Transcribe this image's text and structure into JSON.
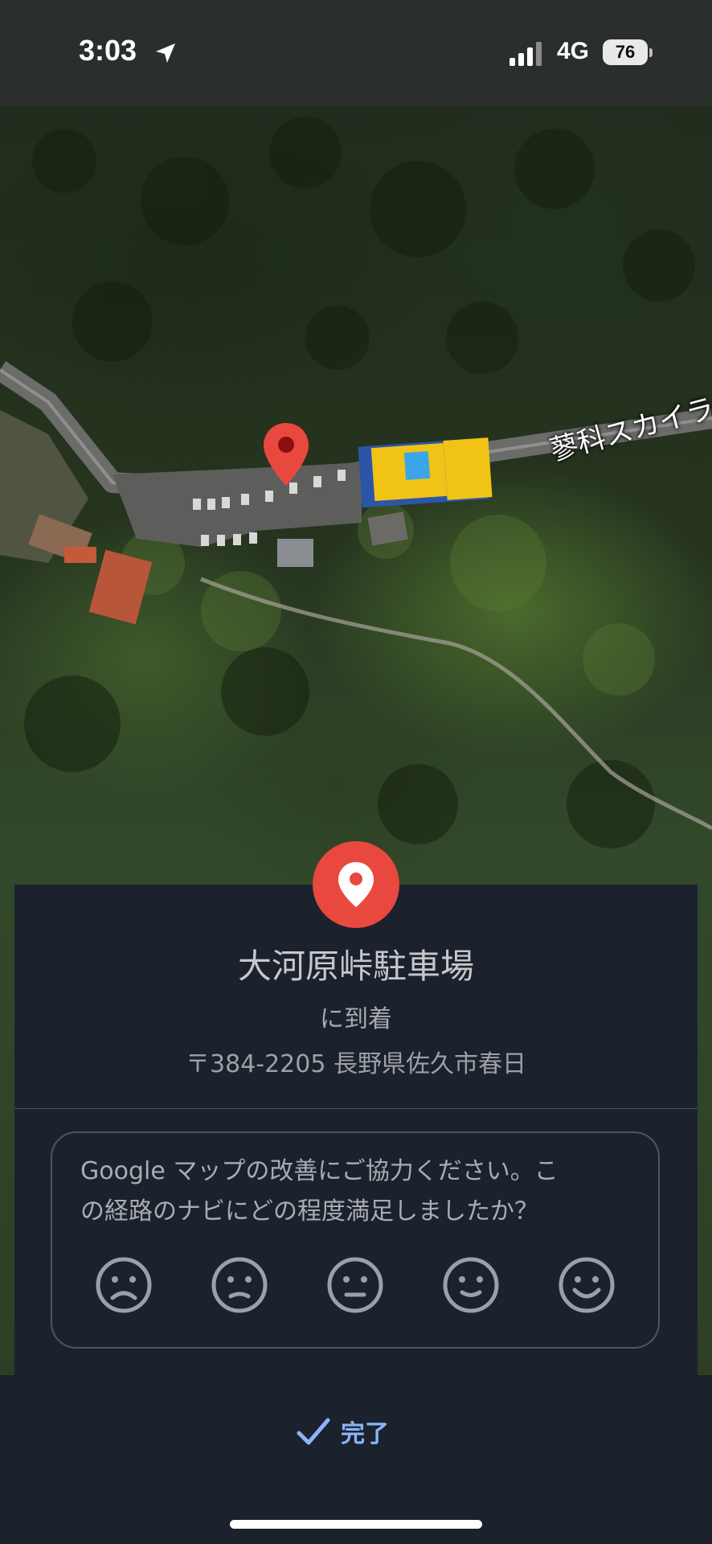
{
  "status_bar": {
    "time": "3:03",
    "network": "4G",
    "battery": "76",
    "icons": [
      "location-arrow-icon",
      "cellular-signal-icon",
      "battery-icon"
    ]
  },
  "map": {
    "road_label": "蓼科スカイラ",
    "pin_color": "#e8483d"
  },
  "arrival": {
    "place_name": "大河原峠駐車場",
    "arrived_text": "に到着",
    "address": "〒384-2205 長野県佐久市春日",
    "badge_icon": "place-pin-icon"
  },
  "feedback": {
    "prompt_line1": "Google マップの改善にご協力ください。こ",
    "prompt_line2": "の経路のナビにどの程度満足しましたか？",
    "ratings": [
      "very-dissatisfied",
      "dissatisfied",
      "neutral",
      "satisfied",
      "very-satisfied"
    ]
  },
  "actions": {
    "done_label": "完了",
    "done_icon": "check-icon",
    "accent_color": "#8ab4f8"
  }
}
